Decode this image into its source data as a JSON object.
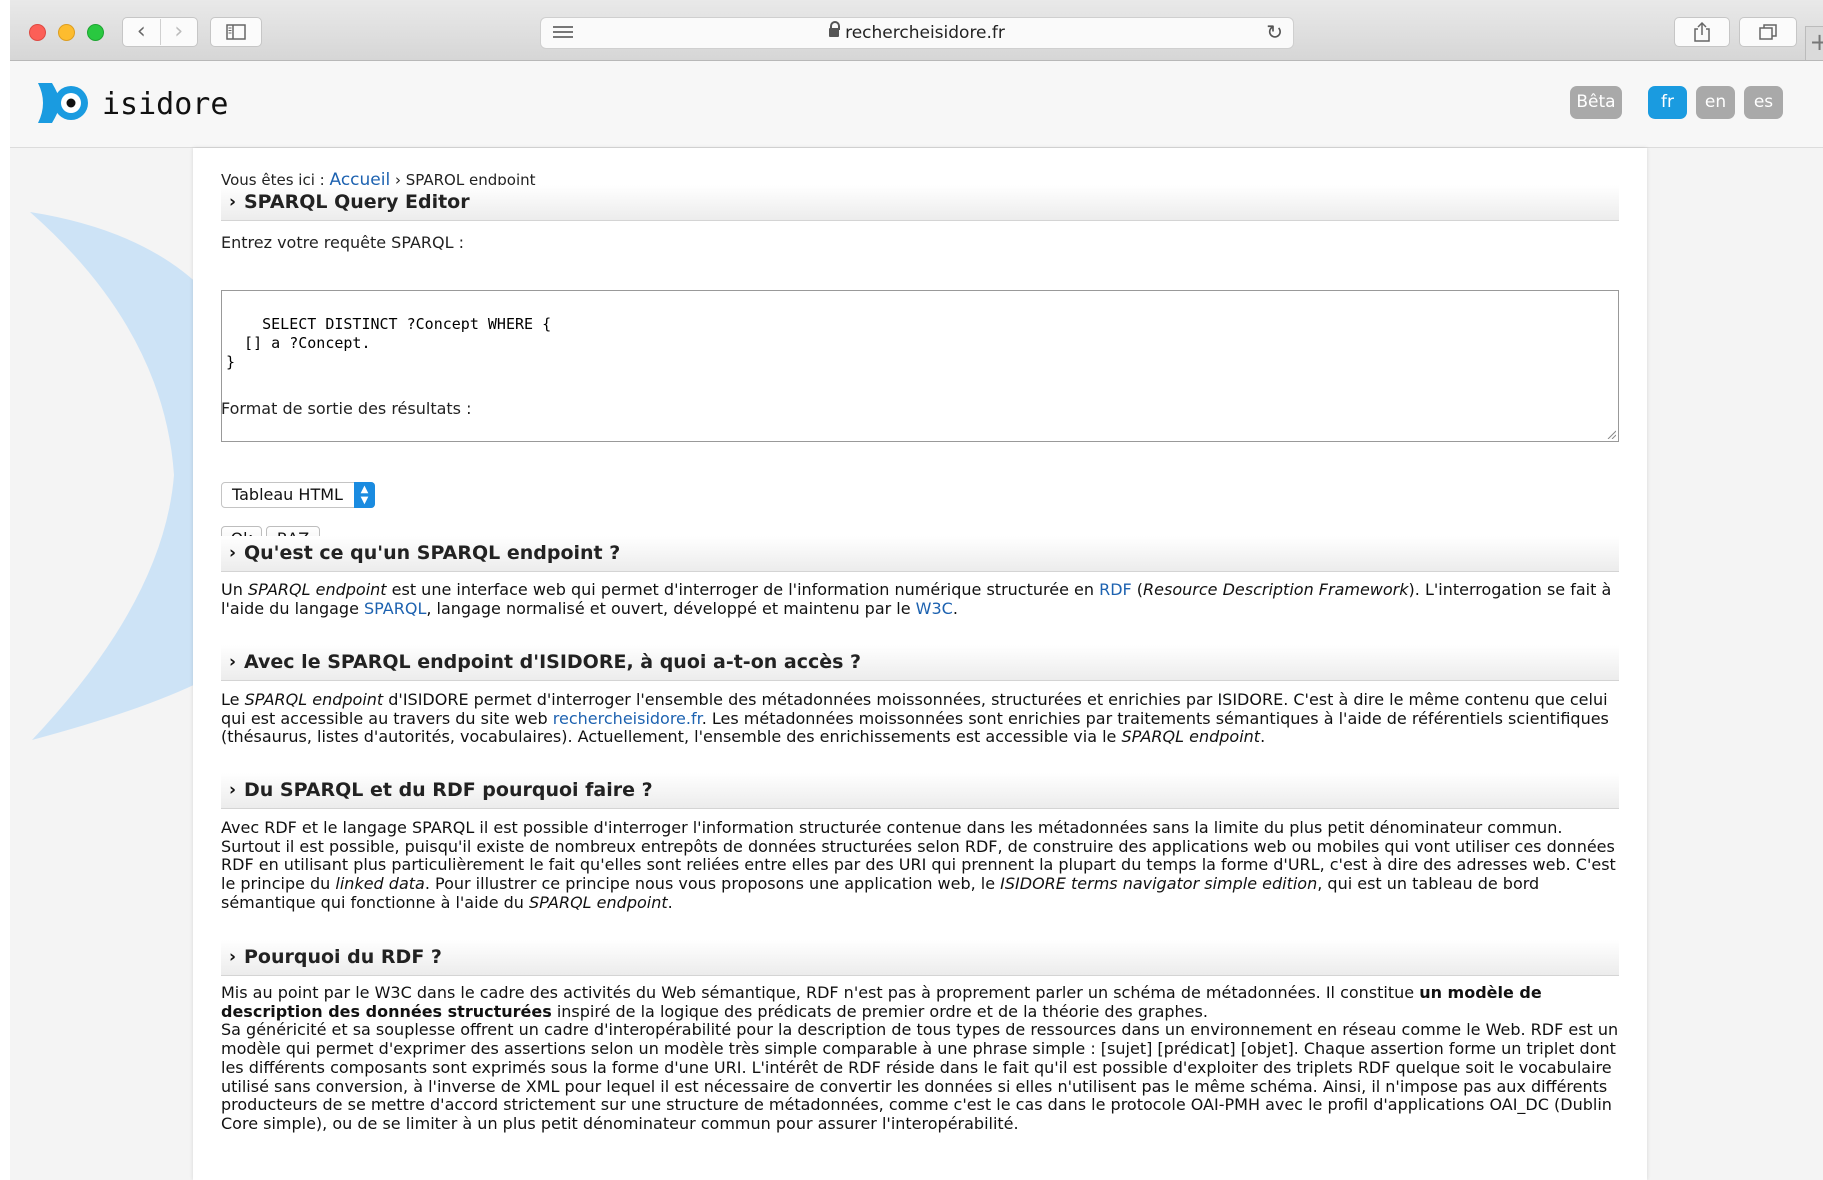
{
  "browser": {
    "url": "rechercheisidore.fr",
    "back_glyph": "‹",
    "forward_glyph": "›",
    "new_tab_glyph": "+"
  },
  "header": {
    "logo_text": "isidore",
    "beta_label": "Bêta",
    "languages": [
      "fr",
      "en",
      "es"
    ],
    "active_language": "fr",
    "accent_color": "#1a9be0"
  },
  "breadcrumb": {
    "prefix": "Vous êtes ici :",
    "home": "Accueil",
    "separator": "›",
    "current": "SPARQL endpoint"
  },
  "editor": {
    "title": "SPARQL Query Editor",
    "query_label": "Entrez votre requête SPARQL :",
    "query": "SELECT DISTINCT ?Concept WHERE {\n  [] a ?Concept.\n}",
    "format_label": "Format de sortie des résultats :",
    "format_value": "Tableau HTML",
    "ok_label": "Ok",
    "reset_label": "RAZ"
  },
  "sections": {
    "s1": {
      "title": "Qu'est ce qu'un SPARQL endpoint ?",
      "t1": "Un ",
      "i1": "SPARQL endpoint",
      "t2": " est une interface web qui permet d'interroger de l'information numérique structurée en ",
      "l1": "RDF",
      "t3": " (",
      "i2": "Resource Description Framework",
      "t4": "). L'interrogation se fait à l'aide du langage ",
      "l2": "SPARQL",
      "t5": ", langage normalisé et ouvert, développé et maintenu par le ",
      "l3": "W3C",
      "t6": "."
    },
    "s2": {
      "title": "Avec le SPARQL endpoint d'ISIDORE, à quoi a-t-on accès ?",
      "t1": "Le ",
      "i1": "SPARQL endpoint",
      "t2": " d'ISIDORE permet d'interroger l'ensemble des métadonnées moissonnées, structurées et enrichies par ISIDORE. C'est à dire le même contenu que celui qui est accessible au travers du site web ",
      "l1": "rechercheisidore.fr",
      "t3": ". Les métadonnées moissonnées sont enrichies par traitements sémantiques à l'aide de référentiels scientifiques (thésaurus, listes d'autorités, vocabulaires). Actuellement, l'ensemble des enrichissements est accessible via le ",
      "i2": "SPARQL endpoint",
      "t4": "."
    },
    "s3": {
      "title": "Du SPARQL et du RDF pourquoi faire ?",
      "t1": "Avec RDF et le langage SPARQL il est possible d'interroger l'information structurée contenue dans les métadonnées sans la limite du plus petit dénominateur commun. Surtout il est possible, puisqu'il existe de nombreux entrepôts de données structurées selon RDF, de construire des applications web ou mobiles qui vont utiliser ces données RDF en utilisant plus particulièrement le fait qu'elles sont reliées entre elles par des URI qui prennent la plupart du temps la forme d'URL, c'est à dire des adresses web. C'est le principe du ",
      "i1": "linked data",
      "t2": ". Pour illustrer ce principe nous vous proposons une application web, le ",
      "i2": "ISIDORE terms navigator simple edition",
      "t3": ", qui est un tableau de bord sémantique qui fonctionne à l'aide du ",
      "i3": "SPARQL endpoint",
      "t4": "."
    },
    "s4": {
      "title": "Pourquoi du RDF ?",
      "t1": "Mis au point par le W3C dans le cadre des activités du Web sémantique, RDF n'est pas à proprement parler un schéma de métadonnées. Il constitue ",
      "b1": "un modèle de description des données structurées",
      "t2": " inspiré de la logique des prédicats de premier ordre et de la théorie des graphes.",
      "p2": "Sa généricité et sa souplesse offrent un cadre d'interopérabilité pour la description de tous types de ressources dans un environnement en réseau comme le Web. RDF est un modèle qui permet d'exprimer des assertions selon un modèle très simple comparable à une phrase simple : [sujet] [prédicat] [objet]. Chaque assertion forme un triplet dont les différents composants sont exprimés sous la forme d'une URI. L'intérêt de RDF réside dans le fait qu'il est possible d'exploiter des triplets RDF quelque soit le vocabulaire utilisé sans conversion, à l'inverse de XML pour lequel il est nécessaire de convertir les données si elles n'utilisent pas le même schéma. Ainsi, il n'impose pas aux différents producteurs de se mettre d'accord strictement sur une structure de métadonnées, comme c'est le cas dans le protocole OAI-PMH avec le profil d'applications OAI_DC (Dublin Core simple), ou de se limiter à un plus petit dénominateur commun pour assurer l'interopérabilité."
    }
  }
}
